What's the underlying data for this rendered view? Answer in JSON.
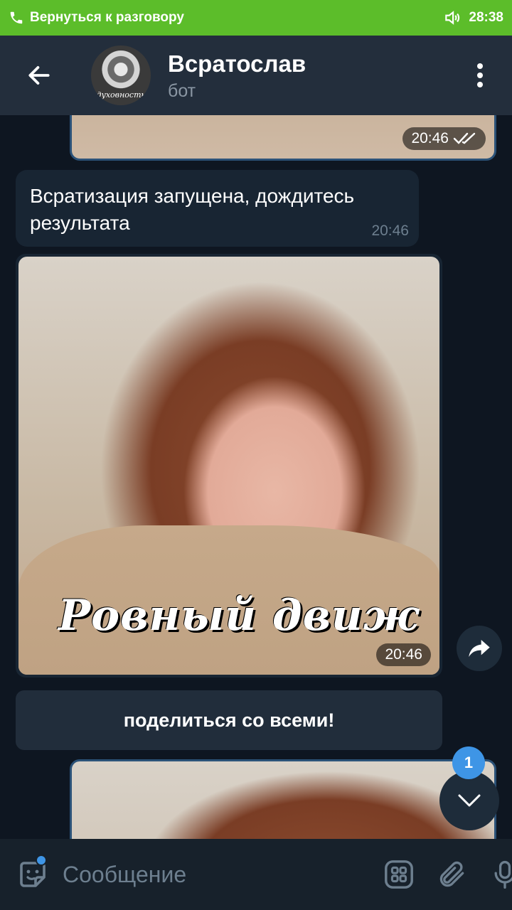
{
  "call_banner": {
    "label": "Вернуться к разговору",
    "time": "28:38"
  },
  "header": {
    "title": "Всратослав",
    "subtitle": "бот",
    "avatar_text": "духовность"
  },
  "messages": {
    "photo_out_top": {
      "time": "20:46",
      "status": "read"
    },
    "text_in": {
      "text": "Всратизация запущена, дождитесь результата",
      "time": "20:46"
    },
    "photo_in": {
      "caption": "Ровный движ",
      "time": "20:46"
    },
    "inline_button": {
      "label": "поделиться со всеми!"
    }
  },
  "scroll": {
    "unread_count": "1"
  },
  "input": {
    "placeholder": "Сообщение"
  },
  "icons": {
    "phone": "phone-icon",
    "sound": "speaker-icon",
    "back": "arrow-left-icon",
    "menu": "more-vertical-icon",
    "share": "share-arrow-icon",
    "scroll_down": "chevron-down-icon",
    "sticker": "sticker-icon",
    "commands": "bot-commands-icon",
    "attach": "paperclip-icon",
    "mic": "microphone-icon",
    "read": "double-check-icon"
  },
  "colors": {
    "banner": "#5cbd2a",
    "header": "#232e3c",
    "chat_bg": "#0e1621",
    "incoming_bubble": "#182533",
    "accent": "#3e95e6"
  }
}
